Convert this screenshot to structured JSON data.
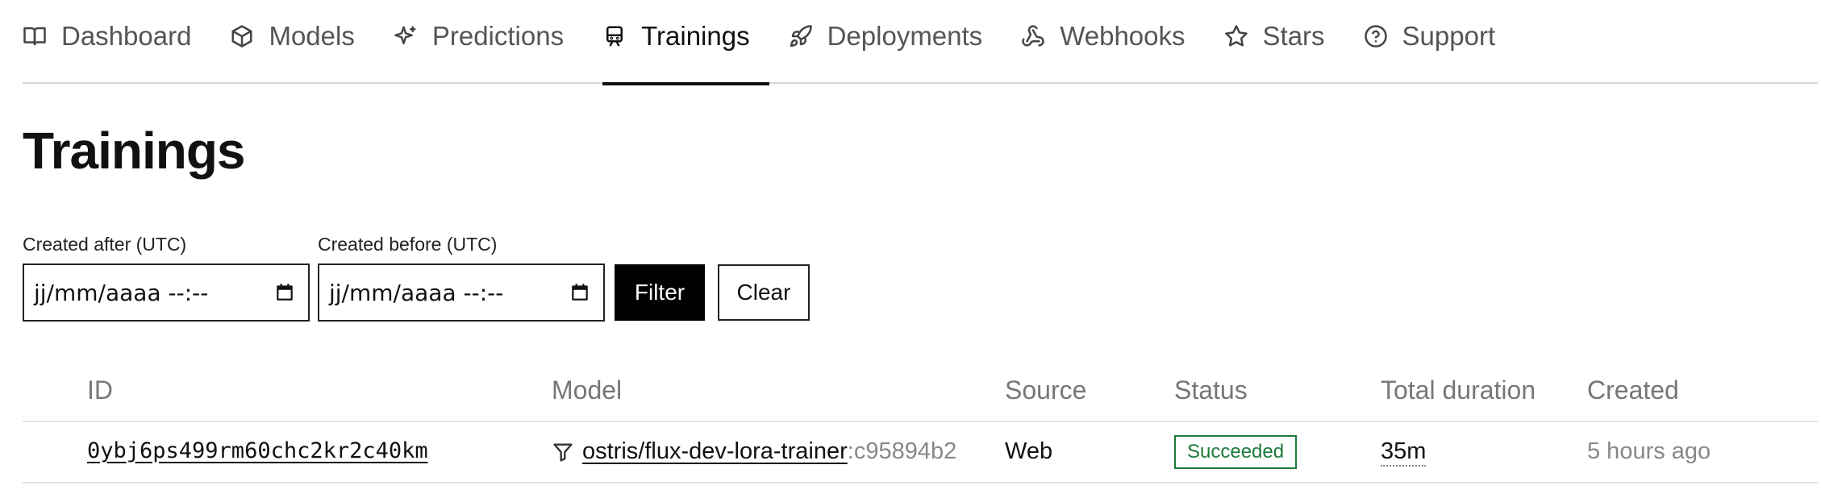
{
  "nav": {
    "items": [
      {
        "label": "Dashboard",
        "icon": "book-icon",
        "active": false
      },
      {
        "label": "Models",
        "icon": "cube-icon",
        "active": false
      },
      {
        "label": "Predictions",
        "icon": "sparkles-icon",
        "active": false
      },
      {
        "label": "Trainings",
        "icon": "train-icon",
        "active": true
      },
      {
        "label": "Deployments",
        "icon": "rocket-icon",
        "active": false
      },
      {
        "label": "Webhooks",
        "icon": "webhook-icon",
        "active": false
      },
      {
        "label": "Stars",
        "icon": "star-icon",
        "active": false
      },
      {
        "label": "Support",
        "icon": "help-circle-icon",
        "active": false
      }
    ]
  },
  "page": {
    "title": "Trainings"
  },
  "filters": {
    "after_label": "Created after (UTC)",
    "after_value": "jj/mm/aaaa --:--",
    "before_label": "Created before (UTC)",
    "before_value": "jj/mm/aaaa --:--",
    "filter_button": "Filter",
    "clear_button": "Clear"
  },
  "table": {
    "headers": {
      "id": "ID",
      "model": "Model",
      "source": "Source",
      "status": "Status",
      "duration": "Total duration",
      "created": "Created"
    },
    "rows": [
      {
        "id": "0ybj6ps499rm60chc2kr2c40km",
        "model": "ostris/flux-dev-lora-trainer",
        "version": ":c95894b2",
        "source": "Web",
        "status": "Succeeded",
        "duration": "35m",
        "created": "5 hours ago"
      }
    ]
  },
  "colors": {
    "status_success": "#1e7a3c",
    "active_underline": "#111111"
  }
}
